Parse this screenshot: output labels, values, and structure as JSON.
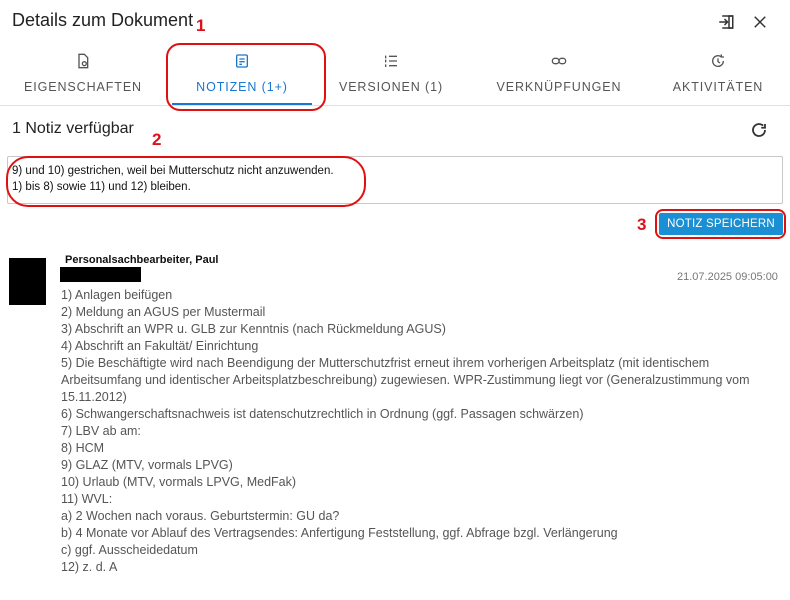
{
  "header": {
    "title": "Details zum Dokument",
    "export_icon": "export-icon",
    "close_icon": "close-icon"
  },
  "tabs": [
    {
      "label": "EIGENSCHAFTEN",
      "icon": "document-properties-icon",
      "active": false
    },
    {
      "label": "NOTIZEN (1+)",
      "icon": "note-icon",
      "active": true
    },
    {
      "label": "VERSIONEN (1)",
      "icon": "versions-list-icon",
      "active": false
    },
    {
      "label": "VERKNÜPFUNGEN",
      "icon": "link-icon",
      "active": false
    },
    {
      "label": "AKTIVITÄTEN",
      "icon": "history-icon",
      "active": false
    }
  ],
  "annotations": {
    "one": "1",
    "two": "2",
    "three": "3"
  },
  "notes": {
    "count_text": "1 Notiz verfügbar",
    "refresh_icon": "refresh-icon",
    "input_value": "9) und 10) gestrichen, weil bei Mutterschutz nicht anzuwenden.\n1) bis 8) sowie 11) und 12) bleiben.",
    "save_label": "NOTIZ SPEICHERN"
  },
  "note_entry": {
    "author": "Personalsachbearbeiter, Paul",
    "timestamp": "21.07.2025 09:05:00",
    "lines": [
      "1)    Anlagen beifügen",
      "2)    Meldung an AGUS per Mustermail",
      "3)    Abschrift an WPR u. GLB zur Kenntnis (nach Rückmeldung AGUS)",
      "4)    Abschrift an Fakultät/ Einrichtung",
      "5)    Die Beschäftigte wird nach Beendigung der Mutterschutzfrist erneut ihrem vorherigen Arbeitsplatz (mit identischem Arbeitsumfang und identischer Arbeitsplatzbeschreibung) zugewiesen. WPR-Zustimmung liegt vor (Generalzustimmung vom 15.11.2012)",
      "6)    Schwangerschaftsnachweis ist datenschutzrechtlich in Ordnung (ggf. Passagen schwärzen)",
      "7)    LBV ab am:",
      "8)    HCM",
      "9)    GLAZ (MTV, vormals LPVG)",
      "10)  Urlaub (MTV, vormals LPVG, MedFak)",
      "11)  WVL:",
      "a)    2 Wochen nach voraus. Geburtstermin: GU da?",
      "b)    4 Monate vor Ablauf des Vertragsendes: Anfertigung Feststellung, ggf. Abfrage bzgl. Verlängerung",
      "c)    ggf. Ausscheidedatum",
      "12)  z. d. A"
    ]
  },
  "colors": {
    "accent": "#1976d2",
    "button": "#1a8fd3",
    "annotation": "#e0101a"
  }
}
